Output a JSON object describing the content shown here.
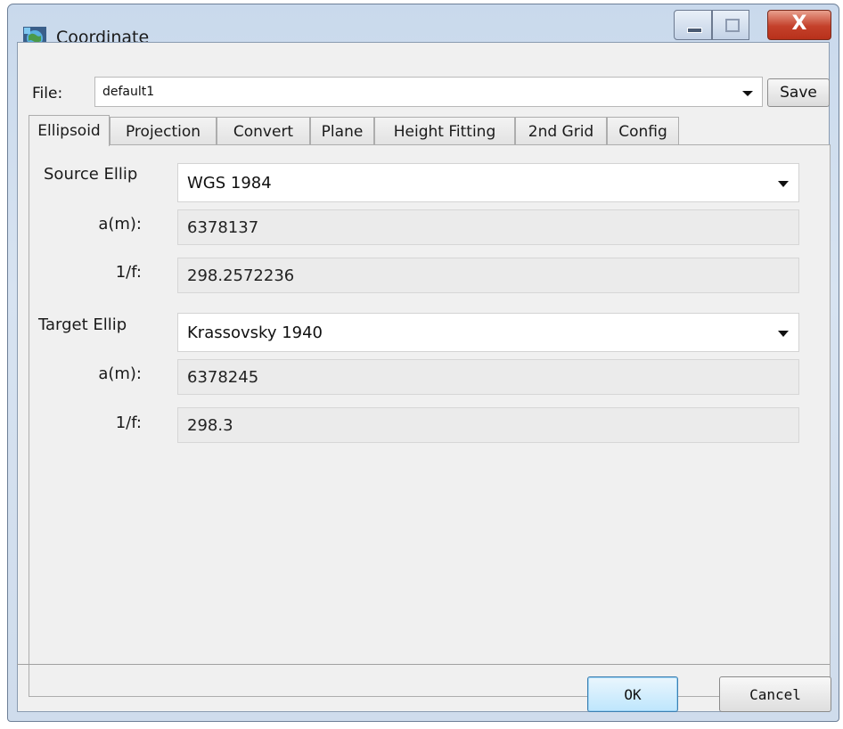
{
  "window": {
    "title": "Coordinate",
    "controls": {
      "minimize": "minimize",
      "maximize": "maximize",
      "close": "X"
    }
  },
  "file": {
    "label": "File:",
    "value": "default1",
    "save_label": "Save"
  },
  "tabs": [
    {
      "label": "Ellipsoid",
      "active": true
    },
    {
      "label": "Projection",
      "active": false
    },
    {
      "label": "Convert",
      "active": false
    },
    {
      "label": "Plane",
      "active": false
    },
    {
      "label": "Height Fitting",
      "active": false
    },
    {
      "label": "2nd Grid",
      "active": false
    },
    {
      "label": "Config",
      "active": false
    }
  ],
  "ellipsoid": {
    "source": {
      "label": "Source Ellip",
      "selected": "WGS 1984",
      "a_label": "a(m):",
      "a_value": "6378137",
      "f_label": "1/f:",
      "f_value": "298.2572236"
    },
    "target": {
      "label": "Target Ellip",
      "selected": "Krassovsky 1940",
      "a_label": "a(m):",
      "a_value": "6378245",
      "f_label": "1/f:",
      "f_value": "298.3"
    }
  },
  "buttons": {
    "ok": "OK",
    "cancel": "Cancel"
  },
  "icons": {
    "app": "globe-app-icon",
    "dropdown": "chevron-down-icon"
  },
  "colors": {
    "accent": "#3c7fb1",
    "close": "#c4402a",
    "frame": "#c9d9ec"
  }
}
